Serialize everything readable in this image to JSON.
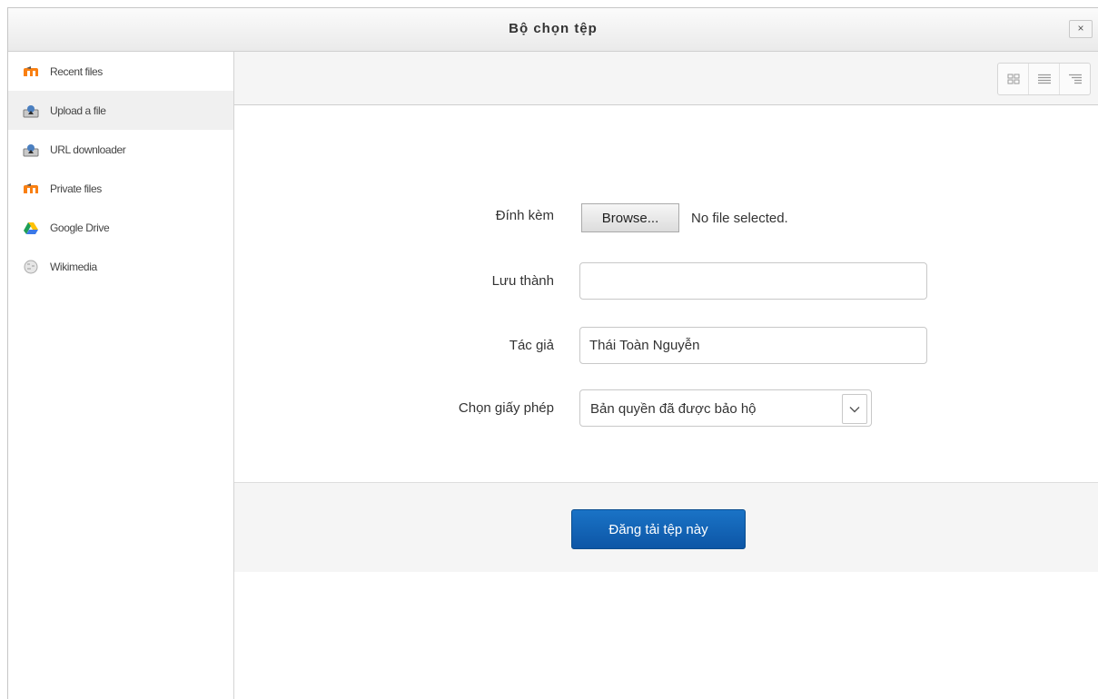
{
  "dialog": {
    "title": "Bộ chọn tệp",
    "close_label": "×"
  },
  "sidebar": {
    "items": [
      {
        "label": "Recent files",
        "icon": "moodle-icon",
        "active": false
      },
      {
        "label": "Upload a file",
        "icon": "upload-icon",
        "active": true
      },
      {
        "label": "URL downloader",
        "icon": "url-download-icon",
        "active": false
      },
      {
        "label": "Private files",
        "icon": "moodle-icon",
        "active": false
      },
      {
        "label": "Google Drive",
        "icon": "google-drive-icon",
        "active": false
      },
      {
        "label": "Wikimedia",
        "icon": "wikimedia-icon",
        "active": false
      }
    ]
  },
  "toolbar": {
    "view_buttons": [
      "icons-view-icon",
      "list-view-icon",
      "tree-view-icon"
    ]
  },
  "form": {
    "attach_label": "Đính kèm",
    "browse_label": "Browse...",
    "no_file_text": "No file selected.",
    "save_as_label": "Lưu thành",
    "save_as_value": "",
    "author_label": "Tác giả",
    "author_value": "Thái Toàn Nguyễn",
    "license_label": "Chọn giấy phép",
    "license_value": "Bản quyền đã được bảo hộ"
  },
  "footer": {
    "upload_button_label": "Đăng tải tệp này"
  },
  "colors": {
    "moodle_orange": "#f98012",
    "primary_button": "#0f5eae"
  }
}
